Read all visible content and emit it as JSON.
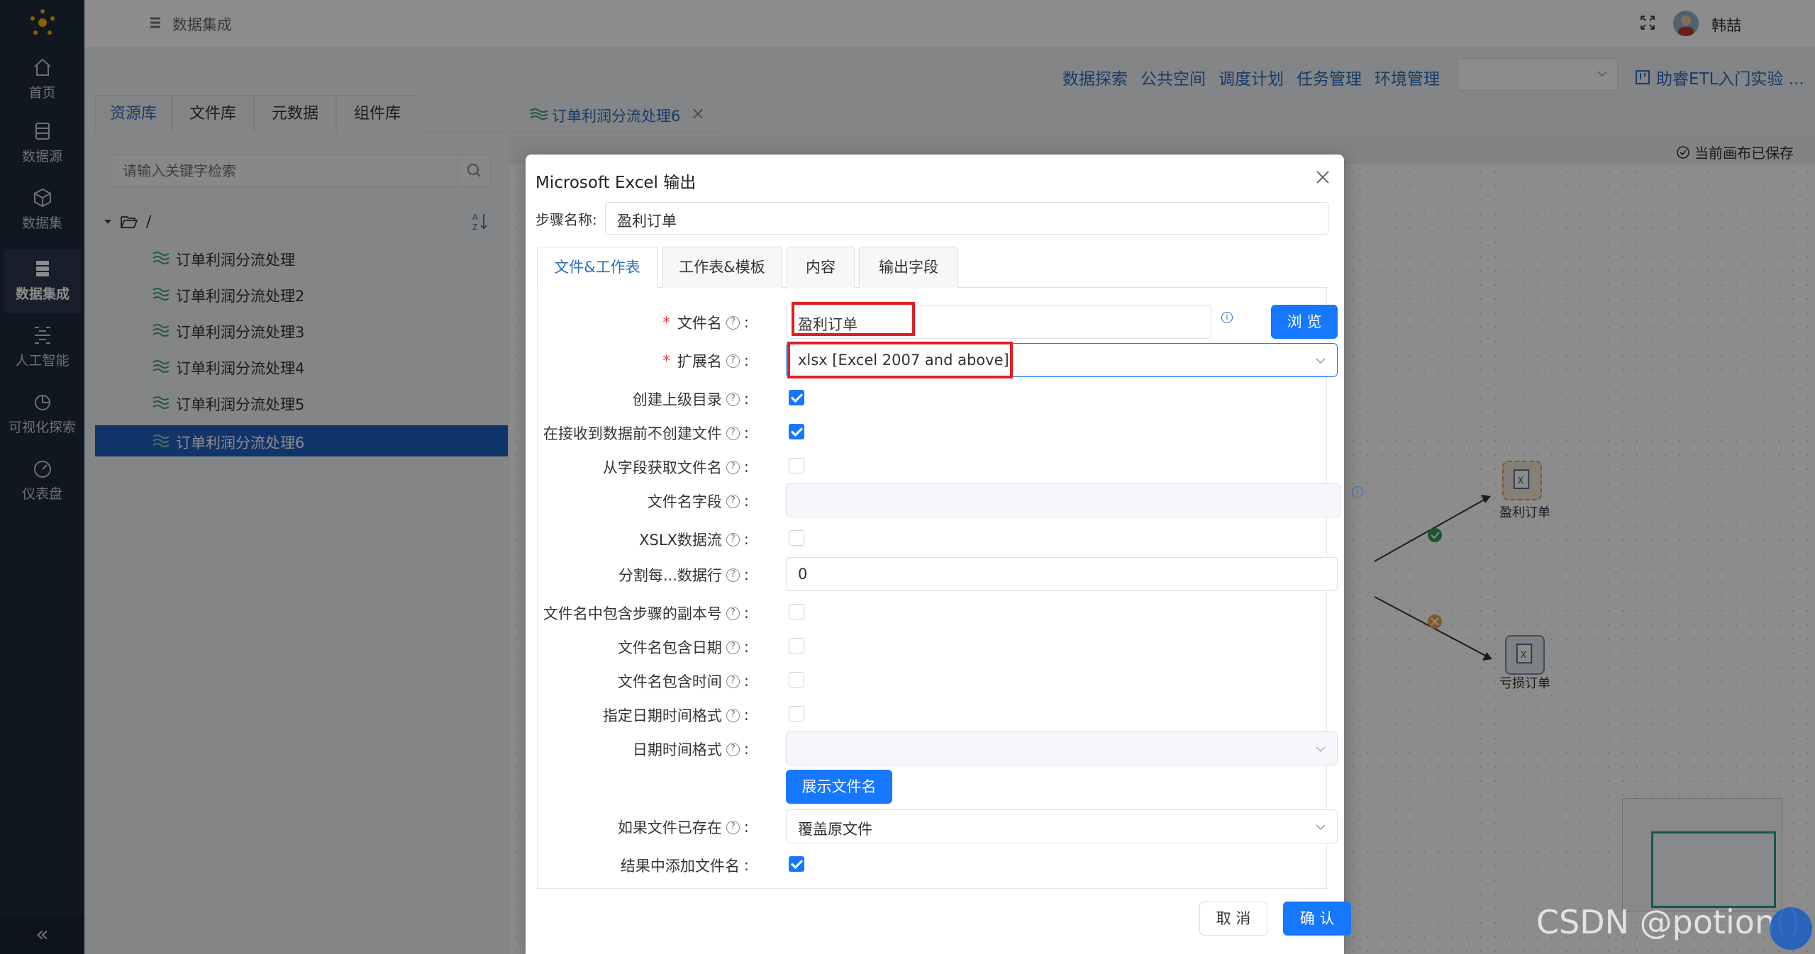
{
  "nav": {
    "items": [
      {
        "label": "首页",
        "icon": "home-icon"
      },
      {
        "label": "数据源",
        "icon": "database-icon"
      },
      {
        "label": "数据集",
        "icon": "cube-icon"
      },
      {
        "label": "数据集成",
        "icon": "server-icon"
      },
      {
        "label": "人工智能",
        "icon": "ai-icon"
      },
      {
        "label": "可视化探索",
        "icon": "pie-chart-icon"
      },
      {
        "label": "仪表盘",
        "icon": "dashboard-icon"
      }
    ],
    "active_index": 3,
    "collapse_label": "«"
  },
  "header": {
    "title": "数据集成",
    "user_name": "韩喆"
  },
  "subbar": {
    "links": [
      "数据探索",
      "公共空间",
      "调度计划",
      "任务管理",
      "环境管理"
    ],
    "env_select_value": "",
    "guide_label": "助睿ETL入门实验 ..."
  },
  "resources": {
    "tabs": [
      "资源库",
      "文件库",
      "元数据",
      "组件库"
    ],
    "active_tab": 0,
    "search_placeholder": "请输入关键字检索",
    "root_label": "/",
    "items": [
      "订单利润分流处理",
      "订单利润分流处理2",
      "订单利润分流处理3",
      "订单利润分流处理4",
      "订单利润分流处理5",
      "订单利润分流处理6"
    ],
    "active_item": 5
  },
  "canvas": {
    "tab_label": "订单利润分流处理6",
    "tab_close": "×",
    "saved_status": "当前画布已保存",
    "nodes": [
      {
        "label": "盈利订单",
        "selected": true
      },
      {
        "label": "亏损订单",
        "selected": false
      }
    ]
  },
  "modal": {
    "title": "Microsoft Excel 输出",
    "step_name_label": "步骤名称:",
    "step_name_value": "盈利订单",
    "tabs": [
      "文件&工作表",
      "工作表&模板",
      "内容",
      "输出字段"
    ],
    "active_tab": 0,
    "fields": {
      "filename": {
        "label": "文件名",
        "value": "盈利订单",
        "required": true
      },
      "browse_button": "浏 览",
      "extension": {
        "label": "扩展名",
        "value": "xlsx [Excel 2007 and above]",
        "required": true
      },
      "create_parent_dir": {
        "label": "创建上级目录",
        "checked": true
      },
      "no_create_until_data": {
        "label": "在接收到数据前不创建文件",
        "checked": true
      },
      "filename_from_field": {
        "label": "从字段获取文件名",
        "checked": false
      },
      "filename_field": {
        "label": "文件名字段",
        "value": ""
      },
      "xlsx_stream": {
        "label": "XSLX数据流",
        "checked": false
      },
      "split_rows": {
        "label": "分割每...数据行",
        "value": "0"
      },
      "include_step_copy": {
        "label": "文件名中包含步骤的副本号",
        "checked": false
      },
      "include_date": {
        "label": "文件名包含日期",
        "checked": false
      },
      "include_time": {
        "label": "文件名包含时间",
        "checked": false
      },
      "specify_datetime_format": {
        "label": "指定日期时间格式",
        "checked": false
      },
      "datetime_format": {
        "label": "日期时间格式",
        "value": ""
      },
      "show_filename_button": "展示文件名",
      "if_file_exists": {
        "label": "如果文件已存在",
        "value": "覆盖原文件"
      },
      "add_filename_to_result": {
        "label": "结果中添加文件名",
        "checked": true
      }
    },
    "cancel_label": "取 消",
    "confirm_label": "确 认"
  },
  "watermark": "CSDN @potion()",
  "colors": {
    "nav_bg": "#1e2a3b",
    "primary": "#1677ff",
    "link": "#2a6ebd",
    "highlight": "#e02020"
  }
}
